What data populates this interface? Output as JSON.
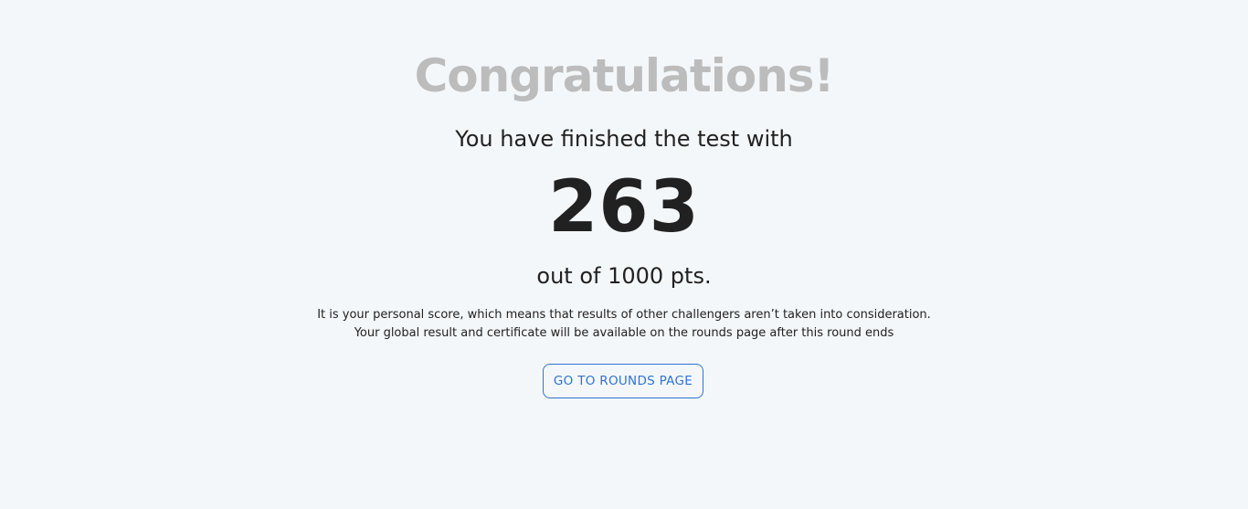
{
  "result": {
    "heading": "Congratulations!",
    "finished_text": "You have finished the test with",
    "score": "263",
    "out_of_text": "out of 1000 pts.",
    "note_line_1": "It is your personal score, which means that results of other challengers aren’t taken into consideration.",
    "note_line_2": "Your global result and certificate will be available on the rounds page after this round ends",
    "button_label": "GO TO ROUNDS PAGE"
  },
  "colors": {
    "background": "#f4f7fa",
    "heading": "#bcbcbc",
    "text": "#212121",
    "accent": "#2f74d0"
  }
}
